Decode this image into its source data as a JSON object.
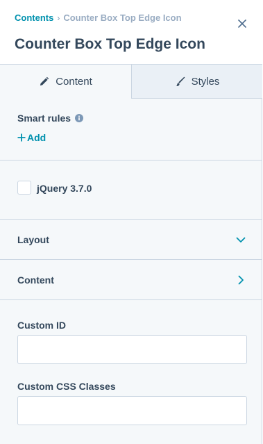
{
  "breadcrumb": {
    "root": "Contents",
    "separator": "›",
    "current": "Counter Box Top Edge Icon"
  },
  "header": {
    "title": "Counter Box Top Edge Icon",
    "close_icon": "close-icon"
  },
  "tabs": [
    {
      "label": "Content",
      "icon": "pencil-icon",
      "active": true
    },
    {
      "label": "Styles",
      "icon": "brush-icon",
      "active": false
    }
  ],
  "smart_rules": {
    "label": "Smart rules",
    "info_icon": "info-icon",
    "add_label": "Add"
  },
  "jquery": {
    "label": "jQuery 3.7.0",
    "checked": false
  },
  "accordions": [
    {
      "label": "Layout",
      "state": "expanded-chevron-down"
    },
    {
      "label": "Content",
      "state": "collapsed-chevron-right"
    }
  ],
  "fields": {
    "custom_id": {
      "label": "Custom ID",
      "value": "",
      "placeholder": ""
    },
    "custom_css": {
      "label": "Custom CSS Classes",
      "value": "",
      "placeholder": ""
    }
  },
  "colors": {
    "accent": "#0091ae",
    "text": "#33475b",
    "muted": "#99acc2",
    "border": "#cbd6e2",
    "panel_bg": "#f5f8fa",
    "inactive_tab_bg": "#eaf0f6"
  }
}
